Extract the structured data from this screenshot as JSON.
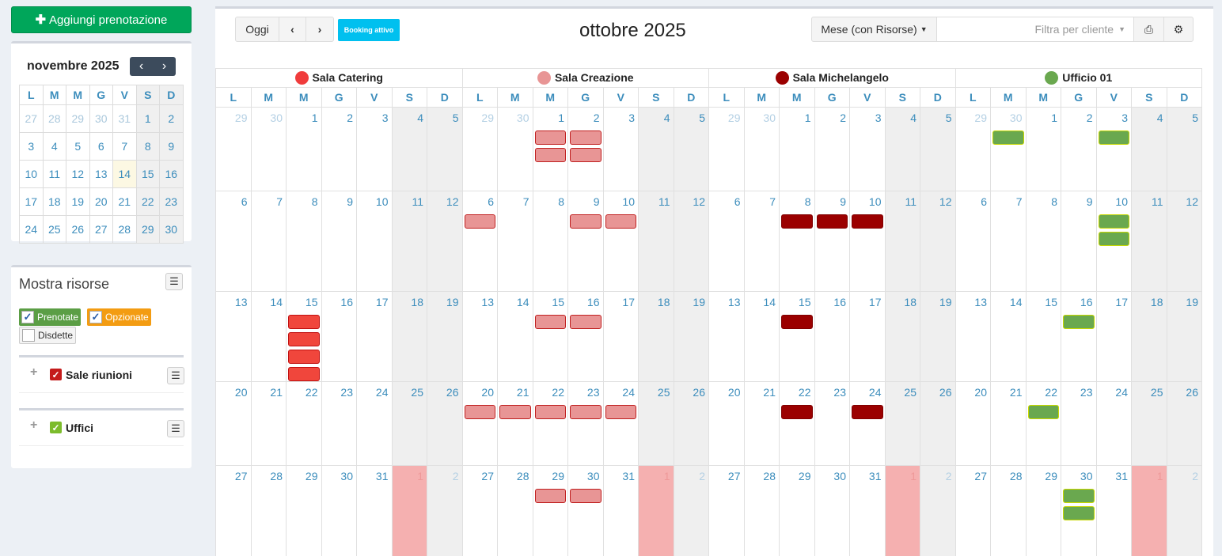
{
  "sidebar": {
    "add_button_label": "Aggiungi prenotazione",
    "mini_calendar": {
      "title": "novembre 2025",
      "headers": [
        "L",
        "M",
        "M",
        "G",
        "V",
        "S",
        "D"
      ],
      "weeks": [
        [
          {
            "d": "27",
            "o": true
          },
          {
            "d": "28",
            "o": true
          },
          {
            "d": "29",
            "o": true
          },
          {
            "d": "30",
            "o": true
          },
          {
            "d": "31",
            "o": true
          },
          {
            "d": "1"
          },
          {
            "d": "2"
          }
        ],
        [
          {
            "d": "3"
          },
          {
            "d": "4"
          },
          {
            "d": "5"
          },
          {
            "d": "6"
          },
          {
            "d": "7"
          },
          {
            "d": "8"
          },
          {
            "d": "9"
          }
        ],
        [
          {
            "d": "10"
          },
          {
            "d": "11"
          },
          {
            "d": "12"
          },
          {
            "d": "13"
          },
          {
            "d": "14",
            "t": true
          },
          {
            "d": "15"
          },
          {
            "d": "16"
          }
        ],
        [
          {
            "d": "17"
          },
          {
            "d": "18"
          },
          {
            "d": "19"
          },
          {
            "d": "20"
          },
          {
            "d": "21"
          },
          {
            "d": "22"
          },
          {
            "d": "23"
          }
        ],
        [
          {
            "d": "24"
          },
          {
            "d": "25"
          },
          {
            "d": "26"
          },
          {
            "d": "27"
          },
          {
            "d": "28"
          },
          {
            "d": "29"
          },
          {
            "d": "30"
          }
        ]
      ]
    },
    "resources": {
      "title": "Mostra risorse",
      "filters": {
        "prenotate": "Prenotate",
        "opzionate": "Opzionate",
        "disdette": "Disdette"
      },
      "groups": [
        {
          "label": "Sale riunioni",
          "color": "#c41b1b"
        },
        {
          "label": "Uffici",
          "color": "#7cbc2c"
        }
      ]
    }
  },
  "toolbar": {
    "today": "Oggi",
    "booking_active": "Booking attivo",
    "title": "ottobre 2025",
    "view": "Mese (con Risorse)",
    "filter_placeholder": "Filtra per cliente"
  },
  "calendar": {
    "day_headers": [
      "L",
      "M",
      "M",
      "G",
      "V",
      "S",
      "D"
    ],
    "weeks": [
      [
        "29",
        "30",
        "1",
        "2",
        "3",
        "4",
        "5"
      ],
      [
        "6",
        "7",
        "8",
        "9",
        "10",
        "11",
        "12"
      ],
      [
        "13",
        "14",
        "15",
        "16",
        "17",
        "18",
        "19"
      ],
      [
        "20",
        "21",
        "22",
        "23",
        "24",
        "25",
        "26"
      ],
      [
        "27",
        "28",
        "29",
        "30",
        "31",
        "1",
        "2"
      ]
    ],
    "resources": [
      {
        "name": "Sala Catering",
        "color": "#f03c3c",
        "event_color": "#f0463c",
        "event_border": "#c01010",
        "events": [
          [],
          [],
          [
            [
              2,
              4
            ]
          ],
          [],
          []
        ]
      },
      {
        "name": "Sala Creazione",
        "color": "#e89595",
        "event_color": "#e89595",
        "event_border": "#c02020",
        "events": [
          [
            [
              2,
              2
            ],
            [
              3,
              2
            ]
          ],
          [
            [
              0,
              1
            ],
            [
              3,
              1
            ],
            [
              4,
              1
            ]
          ],
          [
            [
              2,
              1
            ],
            [
              3,
              1
            ]
          ],
          [
            [
              0,
              1
            ],
            [
              1,
              1
            ],
            [
              2,
              1
            ],
            [
              3,
              1
            ],
            [
              4,
              1
            ]
          ],
          [
            [
              2,
              1
            ],
            [
              3,
              1
            ]
          ]
        ]
      },
      {
        "name": "Sala Michelangelo",
        "color": "#9b0000",
        "event_color": "#9b0000",
        "event_border": "#800000",
        "events": [
          [],
          [
            [
              2,
              1
            ],
            [
              3,
              1
            ],
            [
              4,
              1
            ]
          ],
          [
            [
              2,
              1
            ]
          ],
          [
            [
              2,
              1
            ],
            [
              4,
              1
            ]
          ],
          []
        ]
      },
      {
        "name": "Ufficio 01",
        "color": "#6aa84f",
        "event_color": "#6aa84f",
        "event_border": "#c8d800",
        "events": [
          [
            [
              1,
              1
            ],
            [
              4,
              1
            ]
          ],
          [
            [
              4,
              2
            ]
          ],
          [
            [
              3,
              1
            ]
          ],
          [
            [
              2,
              1
            ]
          ],
          [
            [
              3,
              2
            ]
          ]
        ]
      }
    ]
  }
}
